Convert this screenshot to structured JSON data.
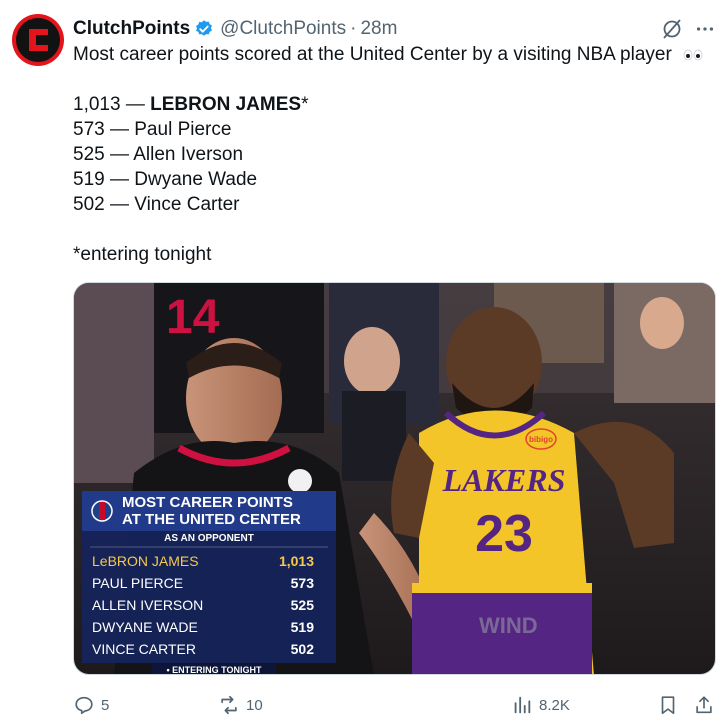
{
  "tweet": {
    "author_name": "ClutchPoints",
    "handle": "@ClutchPoints",
    "separator": "·",
    "time": "28m",
    "lines": [
      "Most career points scored at the United Center by a visiting NBA player",
      "",
      "",
      "573 — Paul Pierce",
      "525 — Allen Iverson",
      "519 — Dwyane Wade",
      "502 — Vince Carter",
      "",
      "*entering tonight"
    ],
    "first_entry_prefix": "1,013 — ",
    "first_entry_name": "LEBRON JAMES",
    "first_entry_suffix": "*"
  },
  "graphic": {
    "title_line1": "MOST CAREER POINTS",
    "title_line2": "AT THE UNITED CENTER",
    "subtitle": "AS AN OPPONENT",
    "rows": [
      {
        "name": "LeBRON JAMES",
        "points": "1,013"
      },
      {
        "name": "PAUL PIERCE",
        "points": "573"
      },
      {
        "name": "ALLEN IVERSON",
        "points": "525"
      },
      {
        "name": "DWYANE WADE",
        "points": "519"
      },
      {
        "name": "VINCE CARTER",
        "points": "502"
      }
    ],
    "footer": "• ENTERING TONIGHT",
    "jersey_left": "14",
    "jersey_right_team": "LAKERS",
    "jersey_right_number": "23",
    "jersey_brand": "bibigo",
    "signage": "WIND"
  },
  "actions": {
    "replies": "5",
    "reposts": "10",
    "views": "8.2K"
  },
  "colors": {
    "brand_red": "#e3141b",
    "verified_blue": "#1d9bf0",
    "secondary_text": "#536471",
    "lakers_gold": "#f4c528",
    "lakers_purple": "#552583",
    "bulls_red": "#ce1141",
    "graphic_navy": "#16245c",
    "graphic_gold": "#f7c948"
  },
  "icons": [
    "clutchpoints-logo",
    "verified-badge-icon",
    "grok-icon",
    "more-icon",
    "eyes-emoji",
    "reply-icon",
    "repost-icon",
    "views-icon",
    "bookmark-icon",
    "share-icon"
  ]
}
